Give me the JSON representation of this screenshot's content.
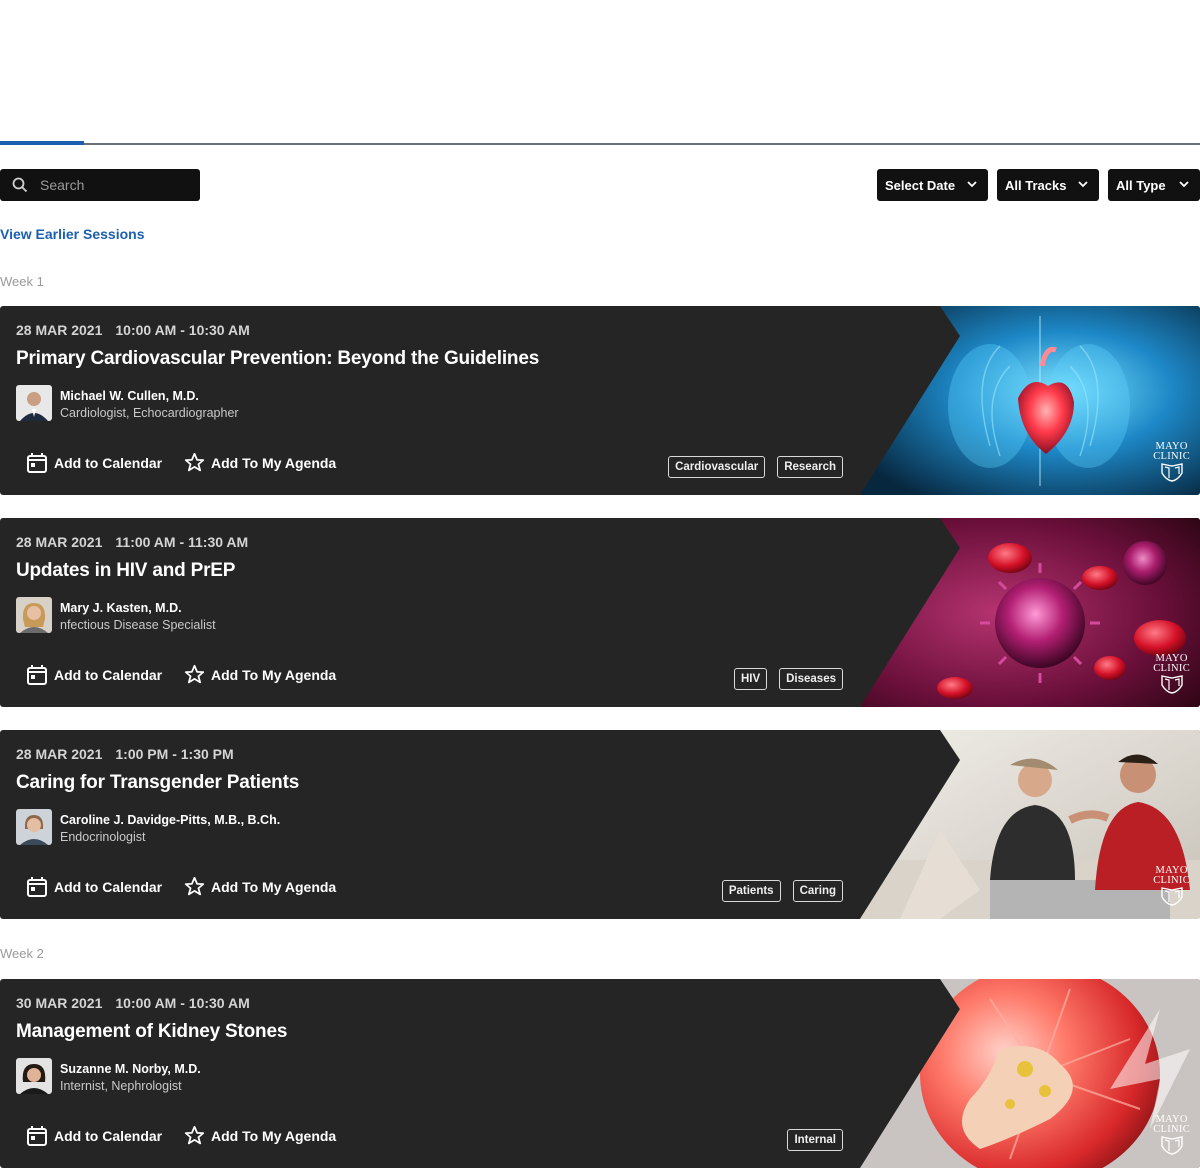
{
  "search": {
    "placeholder": "Search"
  },
  "filters": {
    "date": "Select Date",
    "tracks": "All Tracks",
    "type": "All Type"
  },
  "earlier_link": "View Earlier Sessions",
  "weeks": [
    "Week 1",
    "Week 2"
  ],
  "actions": {
    "calendar": "Add to Calendar",
    "agenda": "Add To My Agenda"
  },
  "brand": {
    "line1": "MAYO",
    "line2": "CLINIC"
  },
  "sessions": [
    {
      "date": "28 MAR 2021",
      "time": "10:00 AM - 10:30 AM",
      "title": "Primary Cardiovascular Prevention: Beyond the Guidelines",
      "speaker": "Michael W. Cullen, M.D.",
      "role": "Cardiologist, Echocardiographer",
      "tags": [
        "Cardiovascular",
        "Research"
      ]
    },
    {
      "date": "28 MAR 2021",
      "time": "11:00 AM - 11:30 AM",
      "title": "Updates in HIV and PrEP",
      "speaker": "Mary J. Kasten, M.D.",
      "role": "nfectious Disease Specialist",
      "tags": [
        "HIV",
        "Diseases"
      ]
    },
    {
      "date": "28 MAR 2021",
      "time": "1:00 PM - 1:30 PM",
      "title": "Caring for Transgender Patients",
      "speaker": "Caroline J. Davidge-Pitts, M.B., B.Ch.",
      "role": "Endocrinologist",
      "tags": [
        "Patients",
        "Caring"
      ]
    },
    {
      "date": "30 MAR 2021",
      "time": "10:00 AM - 10:30 AM",
      "title": "Management of Kidney Stones",
      "speaker": "Suzanne M. Norby, M.D.",
      "role": "Internist, Nephrologist",
      "tags": [
        "Internal"
      ]
    }
  ]
}
